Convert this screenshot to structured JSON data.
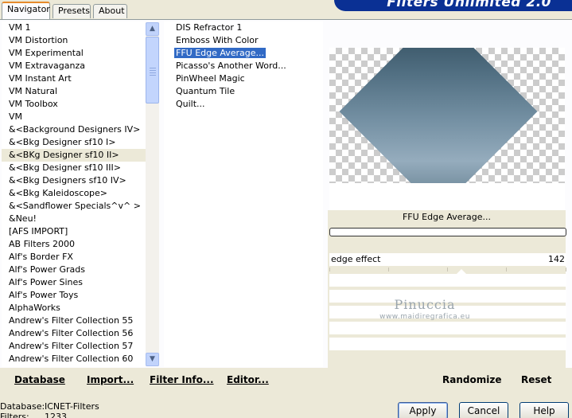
{
  "tabs": [
    {
      "label": "Navigator",
      "active": true
    },
    {
      "label": "Presets",
      "active": false
    },
    {
      "label": "About",
      "active": false
    }
  ],
  "banner": {
    "title": "Filters Unlimited 2.0"
  },
  "categories": {
    "items": [
      "VM 1",
      "VM Distortion",
      "VM Experimental",
      "VM Extravaganza",
      "VM Instant Art",
      "VM Natural",
      "VM Toolbox",
      "VM",
      "&<Background Designers IV>",
      "&<Bkg Designer sf10 I>",
      "&<BKg Designer sf10 II>",
      "&<Bkg Designer sf10 III>",
      "&<Bkg Designers sf10 IV>",
      "&<Bkg Kaleidoscope>",
      "&<Sandflower Specials^v^ >",
      "&Neu!",
      "[AFS IMPORT]",
      "AB Filters 2000",
      "Alf's Border FX",
      "Alf's Power Grads",
      "Alf's Power Sines",
      "Alf's Power Toys",
      "AlphaWorks",
      "Andrew's Filter Collection 55",
      "Andrew's Filter Collection 56",
      "Andrew's Filter Collection 57",
      "Andrew's Filter Collection 60"
    ],
    "selected_index": 10
  },
  "filters": {
    "items": [
      "DIS Refractor 1",
      "Emboss With Color",
      "FFU Edge Average...",
      "Picasso's Another Word...",
      "PinWheel Magic",
      "Quantum Tile",
      "Quilt..."
    ],
    "selected_index": 2
  },
  "preview": {
    "filter_name": "FFU Edge Average...",
    "progress": 0
  },
  "params": [
    {
      "label": "edge effect",
      "value": "142",
      "level": 142,
      "max": 255
    }
  ],
  "watermark": {
    "title": "Pinuccia",
    "url": "www.maidiregrafica.eu"
  },
  "toolbar": {
    "database": "Database",
    "import": "Import...",
    "filter_info": "Filter Info...",
    "editor": "Editor...",
    "randomize": "Randomize",
    "reset": "Reset"
  },
  "status": {
    "database_label": "Database:",
    "database_value": "ICNET-Filters",
    "filters_label": "Filters:",
    "filters_value": "1233"
  },
  "buttons": {
    "apply": "Apply",
    "cancel": "Cancel",
    "help": "Help"
  },
  "colors": {
    "selection": "#316ac5",
    "banner": "#0a3094",
    "dialog_bg": "#ece9d8"
  }
}
